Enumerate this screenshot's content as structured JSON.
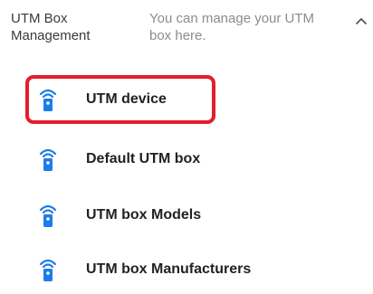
{
  "section": {
    "title": "UTM Box Management",
    "description": "You can manage your UTM box here.",
    "chevron_icon": "chevron-up-icon"
  },
  "menu": {
    "icon": "utm-device-icon",
    "accent_color": "#1a7de8",
    "highlight_color": "#e41d2b",
    "items": [
      {
        "label": "UTM device",
        "highlighted": true
      },
      {
        "label": "Default UTM box",
        "highlighted": false
      },
      {
        "label": "UTM box Models",
        "highlighted": false
      },
      {
        "label": "UTM box Manufacturers",
        "highlighted": false
      }
    ]
  }
}
